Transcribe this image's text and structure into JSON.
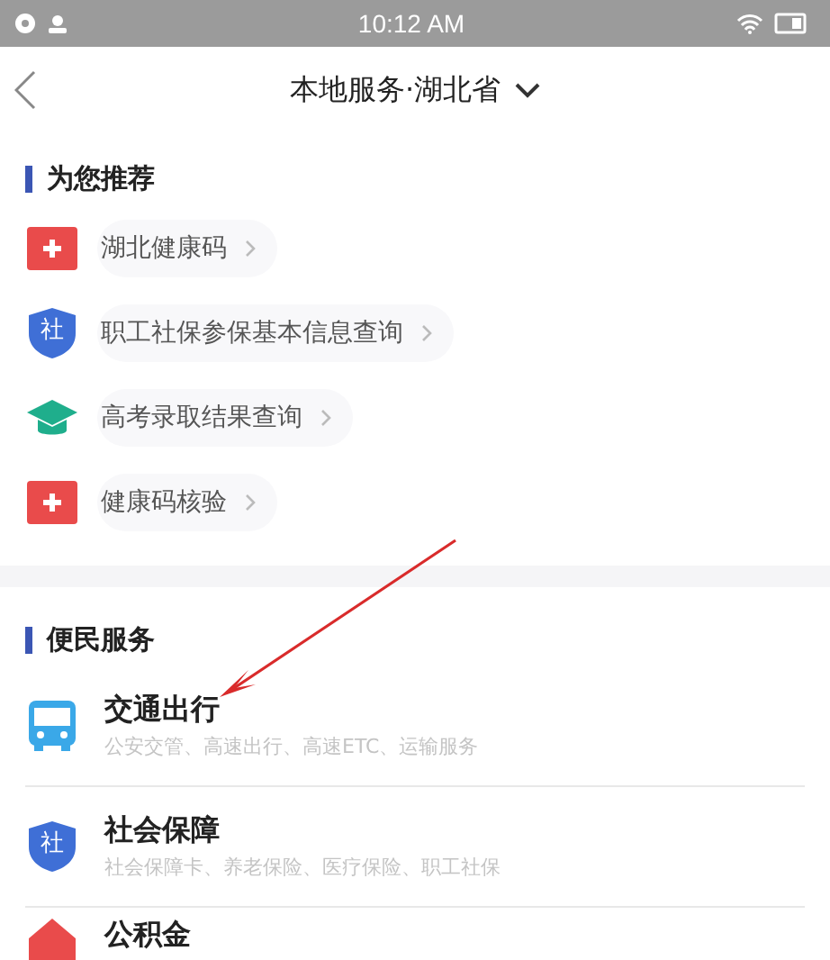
{
  "status_bar": {
    "time": "10:12 AM"
  },
  "header": {
    "title": "本地服务·湖北省"
  },
  "recommended": {
    "title": "为您推荐",
    "items": [
      {
        "label": "湖北健康码",
        "kind": "health"
      },
      {
        "label": "职工社保参保基本信息查询",
        "kind": "social",
        "icon_text": "社"
      },
      {
        "label": "高考录取结果查询",
        "kind": "education"
      },
      {
        "label": "健康码核验",
        "kind": "health"
      }
    ]
  },
  "services": {
    "title": "便民服务",
    "items": [
      {
        "title": "交通出行",
        "subtitle": "公安交管、高速出行、高速ETC、运输服务",
        "kind": "transport"
      },
      {
        "title": "社会保障",
        "subtitle": "社会保障卡、养老保险、医疗保险、职工社保",
        "kind": "social",
        "icon_text": "社"
      },
      {
        "title": "公积金",
        "kind": "fund"
      }
    ]
  }
}
